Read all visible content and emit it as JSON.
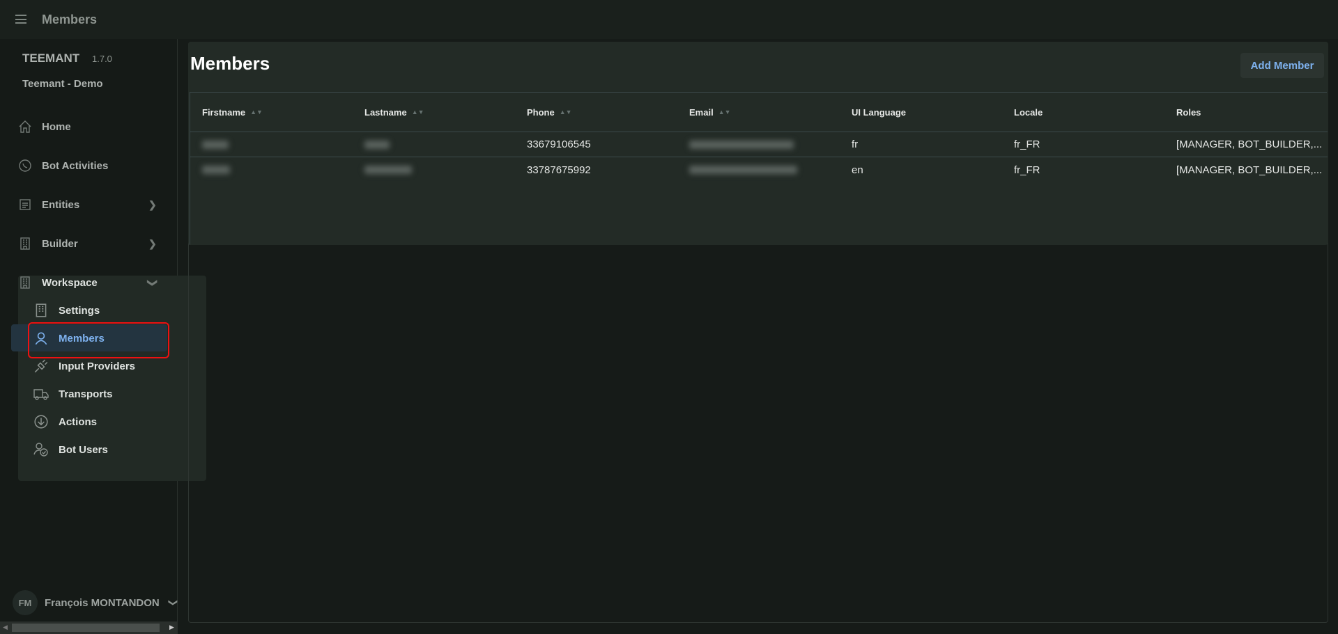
{
  "topbar": {
    "title": "Members"
  },
  "sidebar": {
    "brand": "TEEMANT",
    "version": "1.7.0",
    "workspace_name": "Teemant - Demo",
    "items": [
      {
        "label": "Home",
        "icon": "home-icon"
      },
      {
        "label": "Bot Activities",
        "icon": "whatsapp-icon"
      },
      {
        "label": "Entities",
        "icon": "list-icon"
      },
      {
        "label": "Builder",
        "icon": "building-icon"
      },
      {
        "label": "Workspace",
        "icon": "building-icon"
      }
    ],
    "workspace_items": [
      {
        "label": "Settings"
      },
      {
        "label": "Members",
        "selected": true
      },
      {
        "label": "Input Providers"
      },
      {
        "label": "Transports"
      },
      {
        "label": "Actions"
      },
      {
        "label": "Bot Users"
      }
    ],
    "user": {
      "initials": "FM",
      "name": "François MONTANDON"
    }
  },
  "main": {
    "title": "Members",
    "add_button": "Add Member",
    "columns": [
      "Firstname",
      "Lastname",
      "Phone",
      "Email",
      "UI Language",
      "Locale",
      "Roles"
    ],
    "rows": [
      {
        "phone": "33679106545",
        "ui_language": "fr",
        "locale": "fr_FR",
        "roles": "[MANAGER, BOT_BUILDER,..."
      },
      {
        "phone": "33787675992",
        "ui_language": "en",
        "locale": "fr_FR",
        "roles": "[MANAGER, BOT_BUILDER,..."
      }
    ]
  },
  "colors": {
    "accent": "#7eb2ef",
    "highlight": "#ee1111"
  }
}
